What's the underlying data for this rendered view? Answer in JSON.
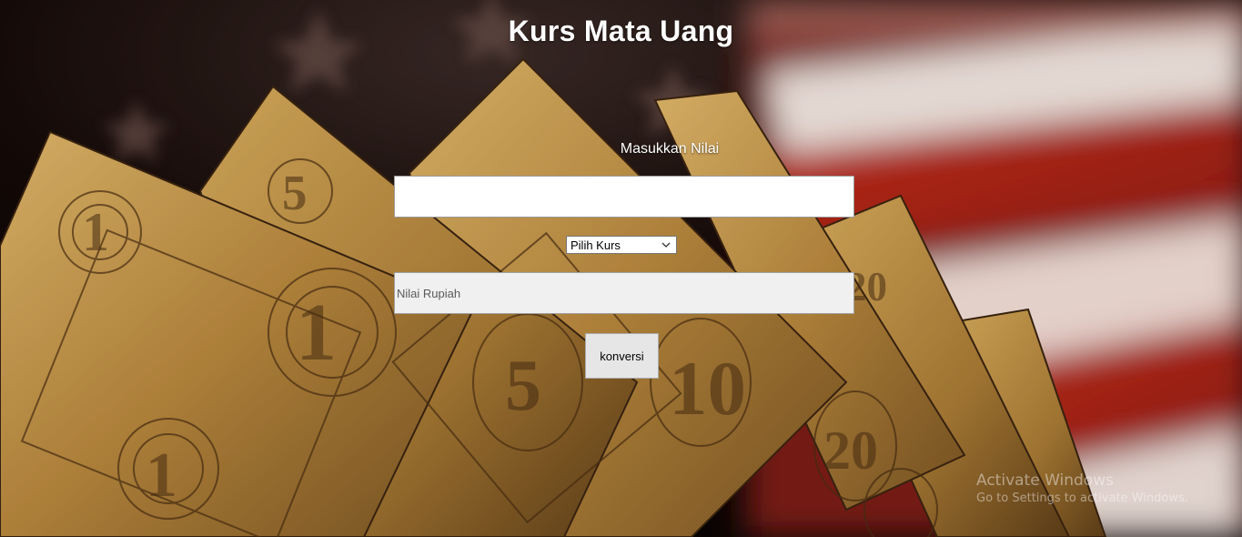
{
  "page": {
    "title": "Kurs Mata Uang"
  },
  "form": {
    "nilai_label": "Masukkan Nilai",
    "nilai_value": "",
    "kurs_select": {
      "selected": "Pilih Kurs"
    },
    "rupiah_placeholder": "Nilai Rupiah",
    "submit_label": "konversi"
  },
  "os_watermark": {
    "title": "Activate Windows",
    "subtitle": "Go to Settings to activate Windows."
  },
  "colors": {
    "title_text": "#ffffff",
    "input_bg": "#ffffff",
    "readonly_bg": "#f0f0f0",
    "button_bg": "#e6e6e6",
    "money_gold": "#c89a4a",
    "flag_red": "#b8261c"
  },
  "icons": {
    "select_arrow": "chevron-down-icon"
  }
}
